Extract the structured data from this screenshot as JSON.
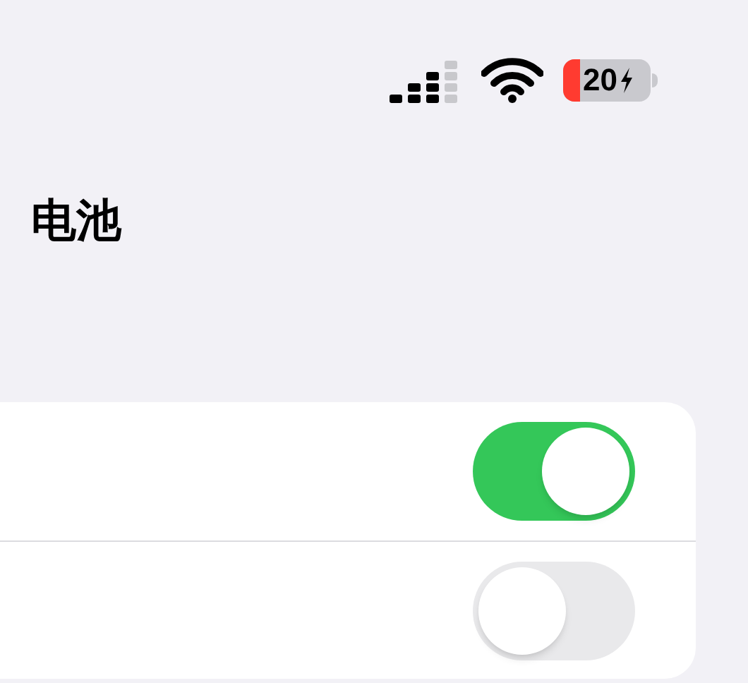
{
  "status_bar": {
    "battery_text": "20"
  },
  "title": "电池",
  "rows": [
    {
      "kind": "toggle",
      "on": true
    },
    {
      "kind": "toggle",
      "on": false
    }
  ]
}
